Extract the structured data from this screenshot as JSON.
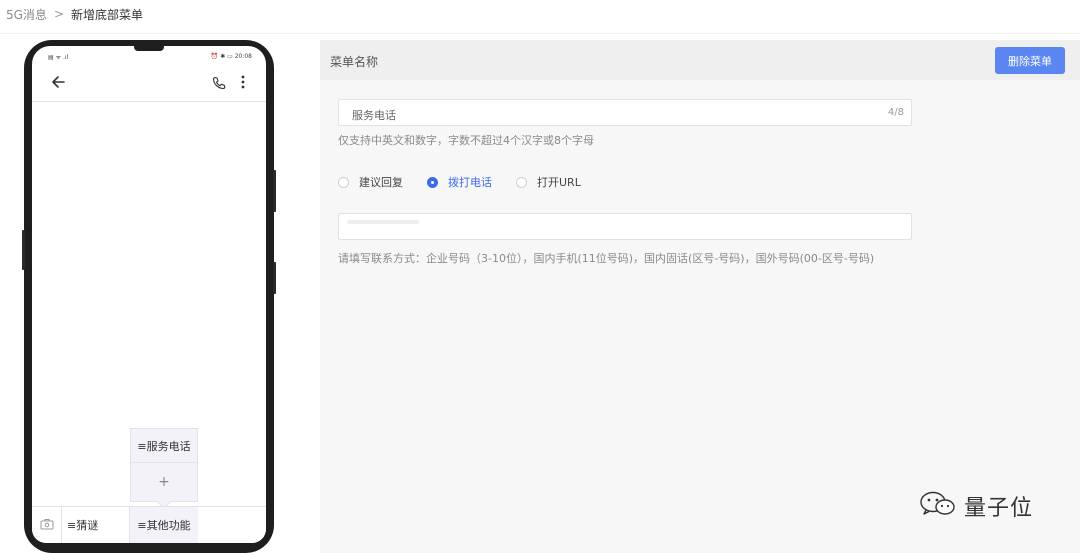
{
  "breadcrumb": {
    "parent": "5G消息",
    "separator": ">",
    "current": "新增底部菜单"
  },
  "phone": {
    "status_left": "▤ ᯤ .ıl",
    "status_right": "⏰ ✱ ▭ 20:08",
    "popup_item": "≡服务电话",
    "popup_add": "+",
    "bottom_menu_1": "≡猜谜",
    "bottom_menu_2": "≡其他功能"
  },
  "panel": {
    "title": "菜单名称",
    "delete_label": "删除菜单",
    "name_value": "服务电话",
    "name_count": "4/8",
    "name_hint": "仅支持中英文和数字，字数不超过4个汉字或8个字母",
    "radios": [
      {
        "label": "建议回复",
        "checked": false
      },
      {
        "label": "拨打电话",
        "checked": true
      },
      {
        "label": "打开URL",
        "checked": false
      }
    ],
    "phone_hint": "请填写联系方式：企业号码（3-10位），国内手机(11位号码)，国内固话(区号-号码)，国外号码(00-区号-号码)"
  },
  "watermark": {
    "text": "量子位"
  },
  "colors": {
    "primary": "#5b86f2",
    "radio_checked": "#3d6be8",
    "panel_bg": "#f7f7f7"
  }
}
